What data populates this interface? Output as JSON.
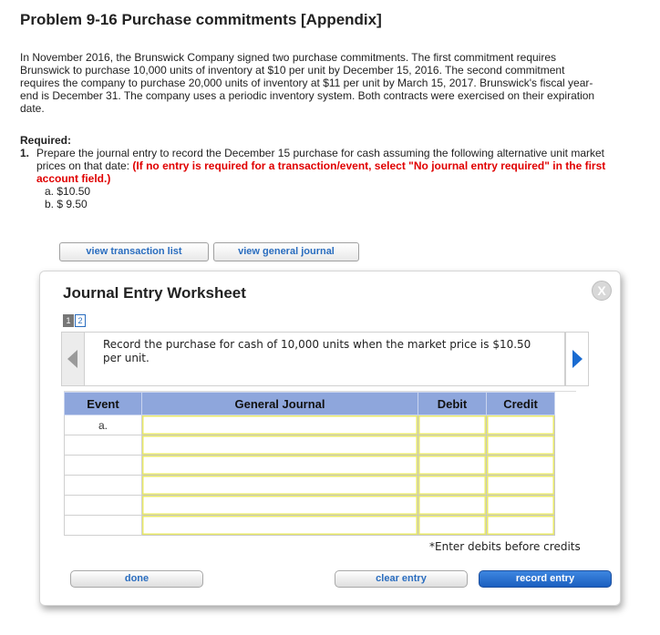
{
  "title": "Problem 9-16 Purchase commitments [Appendix]",
  "intro": "In November 2016, the Brunswick Company signed two purchase commitments. The first commitment requires Brunswick to purchase 10,000 units of inventory at $10 per unit by December 15, 2016. The second commitment requires the company to purchase 20,000 units of inventory at $11 per unit by March 15, 2017. Brunswick's fiscal year-end is December 31. The company uses a periodic inventory system. Both contracts were exercised on their expiration date.",
  "required": {
    "heading": "Required:",
    "number": "1.",
    "text": "Prepare the journal entry to record the December 15 purchase for cash assuming the following alternative unit market prices on that date:",
    "red_text": "(If no entry is required for a transaction/event, select \"No journal entry required\" in the first account field.)",
    "options": [
      "a. $10.50",
      "b. $ 9.50"
    ]
  },
  "buttons": {
    "view_transaction_list": "view transaction list",
    "view_general_journal": "view general journal"
  },
  "worksheet": {
    "title": "Journal Entry Worksheet",
    "close_symbol": "X",
    "pages": [
      "1",
      "2"
    ],
    "current_page": 1,
    "instruction": "Record the purchase for cash of 10,000 units when the market price is $10.50 per unit.",
    "columns": [
      "Event",
      "General Journal",
      "Debit",
      "Credit"
    ],
    "rows": [
      {
        "event": "a.",
        "account": "",
        "debit": "",
        "credit": ""
      },
      {
        "event": "",
        "account": "",
        "debit": "",
        "credit": ""
      },
      {
        "event": "",
        "account": "",
        "debit": "",
        "credit": ""
      },
      {
        "event": "",
        "account": "",
        "debit": "",
        "credit": ""
      },
      {
        "event": "",
        "account": "",
        "debit": "",
        "credit": ""
      },
      {
        "event": "",
        "account": "",
        "debit": "",
        "credit": ""
      }
    ],
    "note": "*Enter debits before credits",
    "done_label": "done",
    "clear_label": "clear entry",
    "record_label": "record entry"
  },
  "colors": {
    "header_blue": "#8ea6dc",
    "required_red": "#e00000",
    "link_blue": "#2a6dbf",
    "record_button": "#1b5fc0",
    "input_border_yellow": "#e9e96a"
  },
  "icons": {
    "close": "close-icon",
    "prev": "chevron-left-icon",
    "next": "chevron-right-icon"
  }
}
